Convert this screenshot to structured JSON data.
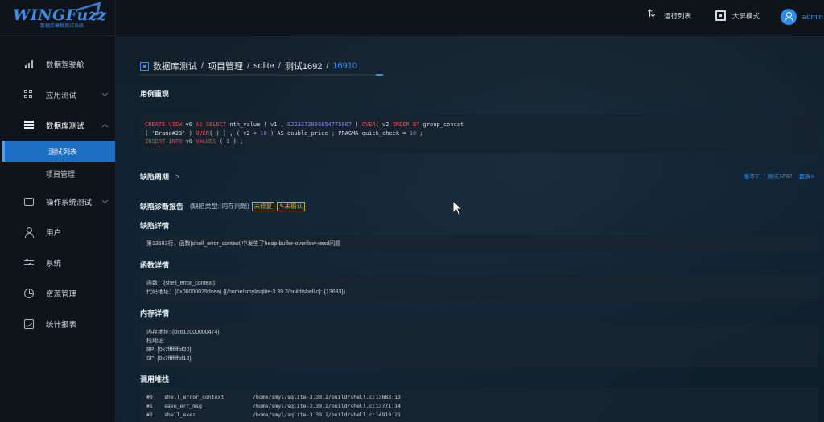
{
  "logo": {
    "main": "WINGFuzz",
    "sub": "数据库模糊测试系统"
  },
  "sidebar": {
    "items": [
      {
        "label": "数据驾驶舱",
        "icon": "bar-chart-icon"
      },
      {
        "label": "应用测试",
        "icon": "grid-icon"
      },
      {
        "label": "数据库测试",
        "icon": "database-icon"
      },
      {
        "label": "操作系统测试",
        "icon": "monitor-icon"
      },
      {
        "label": "用户",
        "icon": "user-icon"
      },
      {
        "label": "系统",
        "icon": "sliders-icon"
      },
      {
        "label": "资源管理",
        "icon": "pie-chart-icon"
      },
      {
        "label": "统计报表",
        "icon": "report-icon"
      }
    ],
    "sub_items": [
      {
        "label": "测试列表",
        "active": true
      },
      {
        "label": "项目管理",
        "active": false
      }
    ]
  },
  "topbar": {
    "run_list": "运行列表",
    "fullscreen": "大屏模式",
    "user": "admin"
  },
  "breadcrumb": {
    "items": [
      "数据库测试",
      "项目管理",
      "sqlite",
      "测试1692",
      "16910"
    ]
  },
  "repro": {
    "title": "用例重现",
    "line1_a": "CREATE VIEW",
    "line1_b": " v0 ",
    "line1_c": "AS SELECT",
    "line1_d": " nth_value ( v1 , ",
    "line1_e": "9223372036854775807",
    "line1_f": " ) ",
    "line1_g": "OVER",
    "line1_h": "( v2 ",
    "line1_i": "ORDER BY",
    "line1_j": " group_concat",
    "line2_a": "( 'Brand#23' ) ",
    "line2_b": "OVER",
    "line2_c": "( ) ) , ( v2 + ",
    "line2_d": "10",
    "line2_e": " ) AS double_price ; PRAGMA quick_check = ",
    "line2_f": "10",
    "line2_g": " ;",
    "line3_a": "INSERT INTO",
    "line3_b": " v0 ",
    "line3_c": "VALUES",
    "line3_d": " ( ",
    "line3_e": "1",
    "line3_f": " ) ;"
  },
  "cycle": {
    "title": "缺陷周期",
    "arrow": ">",
    "version_link": "版本11 / 测试1692",
    "more_link": "更多>"
  },
  "report": {
    "title": "缺陷诊断报告",
    "type": "(缺陷类型: 内存问题)",
    "badge_unfixed": "未修复",
    "badge_unconfirmed": "未确认"
  },
  "defect_detail": {
    "title": "缺陷详情",
    "text": "第13683行，函数{shell_error_context}中发生了heap-buffer-overflow-read问题"
  },
  "function_detail": {
    "title": "函数详情",
    "line1": "函数：{shell_error_context}",
    "line2": "代码地址：{0x00000079dcea}  {{/home/smyl/sqlite-3.39.2/build/shell.c}: {13683}}"
  },
  "memory_detail": {
    "title": "内存详情",
    "line1": "内存地址: {0x612000000474}",
    "line2": "栈地址:",
    "line3": "BP: {0x7fffffffbf20}",
    "line4": "SP: {0x7fffffffbf18}"
  },
  "call_stack": {
    "title": "调用堆栈",
    "rows": [
      {
        "idx": "#0",
        "fn": "shell_error_context",
        "loc": "/home/smyl/sqlite-3.39.2/build/shell.c:13683:13"
      },
      {
        "idx": "#1",
        "fn": "save_err_msg",
        "loc": "/home/smyl/sqlite-3.39.2/build/shell.c:13771:14"
      },
      {
        "idx": "#2",
        "fn": "shell_exec",
        "loc": "/home/smyl/sqlite-3.39.2/build/shell.c:14919:21"
      }
    ]
  },
  "colors": {
    "accent": "#3d8ee8",
    "keyword": "#e04c55",
    "number": "#9b7ee0",
    "badge": "#e0a52a"
  }
}
